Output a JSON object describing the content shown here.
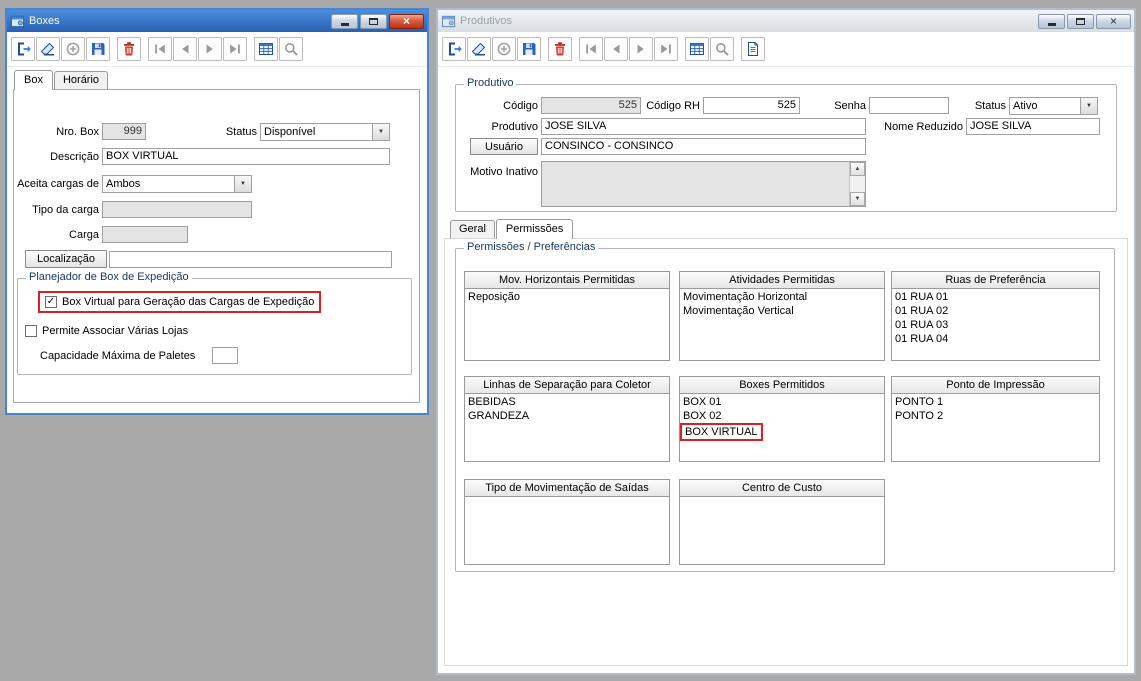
{
  "boxes_window": {
    "title": "Boxes",
    "toolbar": [
      "exit",
      "clear",
      "add",
      "save",
      "delete",
      "first",
      "previous",
      "next",
      "last",
      "grid",
      "search"
    ],
    "tabs": [
      {
        "label": "Box",
        "selected": true
      },
      {
        "label": "Horário",
        "selected": false
      }
    ],
    "form": {
      "nro_box": {
        "label": "Nro. Box",
        "value": "999"
      },
      "status": {
        "label": "Status",
        "value": "Disponível"
      },
      "descricao": {
        "label": "Descrição",
        "value": "BOX VIRTUAL"
      },
      "aceita_cargas": {
        "label": "Aceita cargas de",
        "value": "Ambos"
      },
      "tipo_carga": {
        "label": "Tipo da carga",
        "value": ""
      },
      "carga": {
        "label": "Carga",
        "value": ""
      },
      "localizacao": {
        "label": "Localização",
        "value": ""
      }
    },
    "planejador": {
      "title": "Planejador de Box de Expedição",
      "box_virtual_checkbox": {
        "label": "Box Virtual para Geração das Cargas de Expedição",
        "checked": true
      },
      "varias_lojas_checkbox": {
        "label": "Permite Associar Várias Lojas",
        "checked": false
      },
      "capacidade": {
        "label": "Capacidade Máxima de Paletes",
        "value": ""
      }
    }
  },
  "produtivos_window": {
    "title": "Produtivos",
    "toolbar": [
      "exit",
      "clear",
      "add",
      "save",
      "delete",
      "first",
      "previous",
      "next",
      "last",
      "grid",
      "search",
      "report"
    ],
    "produtivo": {
      "title": "Produtivo",
      "codigo": {
        "label": "Código",
        "value": "525"
      },
      "codigo_rh": {
        "label": "Código RH",
        "value": "525"
      },
      "senha": {
        "label": "Senha",
        "value": ""
      },
      "status": {
        "label": "Status",
        "value": "Ativo"
      },
      "produtivo_nome": {
        "label": "Produtivo",
        "value": "JOSE SILVA"
      },
      "nome_reduzido": {
        "label": "Nome Reduzido",
        "value": "JOSE SILVA"
      },
      "usuario": {
        "label": "Usuário",
        "value": "CONSINCO - CONSINCO"
      },
      "motivo_inativo": {
        "label": "Motivo Inativo",
        "value": ""
      }
    },
    "tabs": [
      {
        "label": "Geral",
        "selected": false
      },
      {
        "label": "Permissões",
        "selected": true
      }
    ],
    "permissoes": {
      "title": "Permissões / Preferências",
      "panels": [
        {
          "title": "Mov. Horizontais Permitidas",
          "items": [
            "Reposição"
          ]
        },
        {
          "title": "Atividades Permitidas",
          "items": [
            "Movimentação Horizontal",
            "Movimentação Vertical"
          ]
        },
        {
          "title": "Ruas de Preferência",
          "items": [
            "01 RUA 01",
            "01 RUA 02",
            "01 RUA 03",
            "01 RUA 04"
          ]
        },
        {
          "title": "Linhas de Separação para Coletor",
          "items": [
            "BEBIDAS",
            "GRANDEZA"
          ]
        },
        {
          "title": "Boxes Permitidos",
          "items": [
            "BOX 01",
            "BOX 02",
            "BOX VIRTUAL"
          ],
          "highlighted_item": "BOX VIRTUAL"
        },
        {
          "title": "Ponto de Impressão",
          "items": [
            "PONTO 1",
            "PONTO 2"
          ]
        },
        {
          "title": "Tipo de Movimentação de Saídas",
          "items": []
        },
        {
          "title": "Centro de Custo",
          "items": []
        }
      ]
    }
  }
}
